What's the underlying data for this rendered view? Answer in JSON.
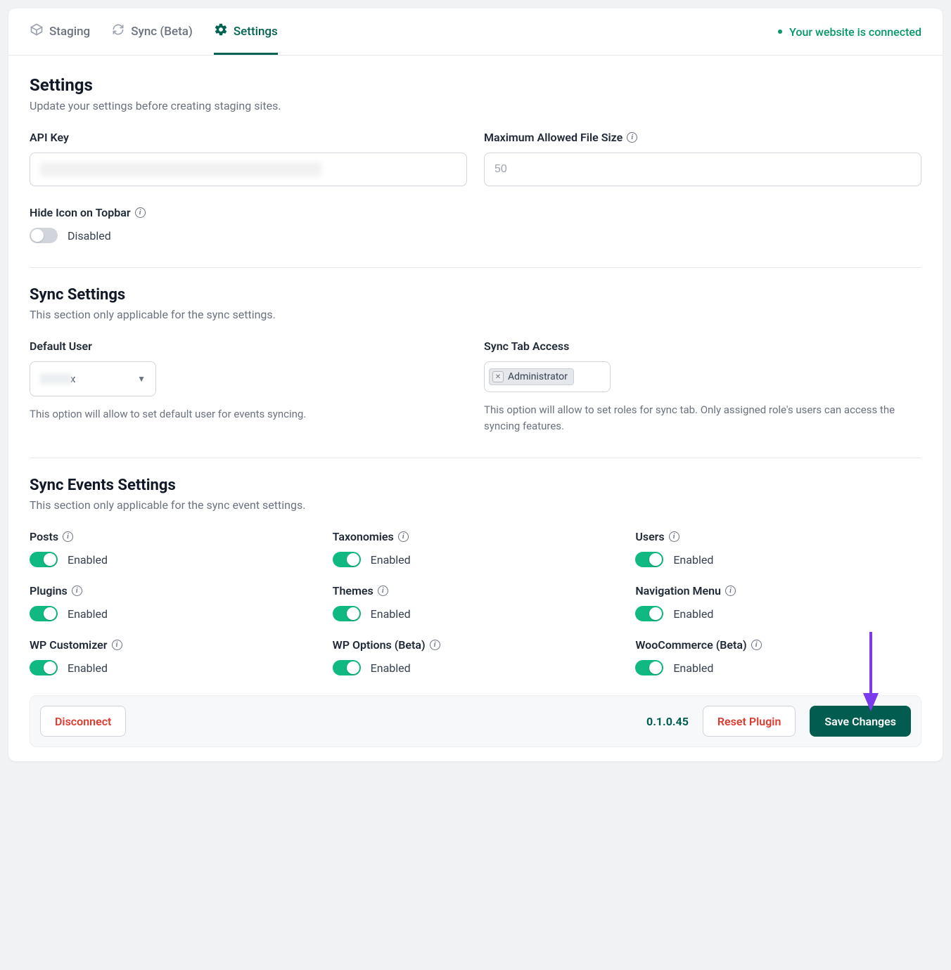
{
  "tabs": {
    "staging": "Staging",
    "sync": "Sync (Beta)",
    "settings": "Settings"
  },
  "status_text": "Your website is connected",
  "page": {
    "title": "Settings",
    "subtitle": "Update your settings before creating staging sites."
  },
  "fields": {
    "api_key_label": "API Key",
    "max_file_label": "Maximum Allowed File Size",
    "max_file_placeholder": "50",
    "hide_icon_label": "Hide Icon on Topbar",
    "hide_icon_state": "Disabled"
  },
  "sync": {
    "title": "Sync Settings",
    "subtitle": "This section only applicable for the sync settings.",
    "default_user_label": "Default User",
    "default_user_tail": "x",
    "default_user_help": "This option will allow to set default user for events syncing.",
    "tab_access_label": "Sync Tab Access",
    "tab_access_chip": "Administrator",
    "tab_access_help": "This option will allow to set roles for sync tab. Only assigned role's users can access the syncing features."
  },
  "events_section": {
    "title": "Sync Events Settings",
    "subtitle": "This section only applicable for the sync event settings."
  },
  "events": [
    {
      "label": "Posts",
      "state": "Enabled"
    },
    {
      "label": "Taxonomies",
      "state": "Enabled"
    },
    {
      "label": "Users",
      "state": "Enabled"
    },
    {
      "label": "Plugins",
      "state": "Enabled"
    },
    {
      "label": "Themes",
      "state": "Enabled"
    },
    {
      "label": "Navigation Menu",
      "state": "Enabled"
    },
    {
      "label": "WP Customizer",
      "state": "Enabled"
    },
    {
      "label": "WP Options (Beta)",
      "state": "Enabled"
    },
    {
      "label": "WooCommerce (Beta)",
      "state": "Enabled"
    }
  ],
  "footer": {
    "disconnect": "Disconnect",
    "version": "0.1.0.45",
    "reset": "Reset Plugin",
    "save": "Save Changes"
  }
}
